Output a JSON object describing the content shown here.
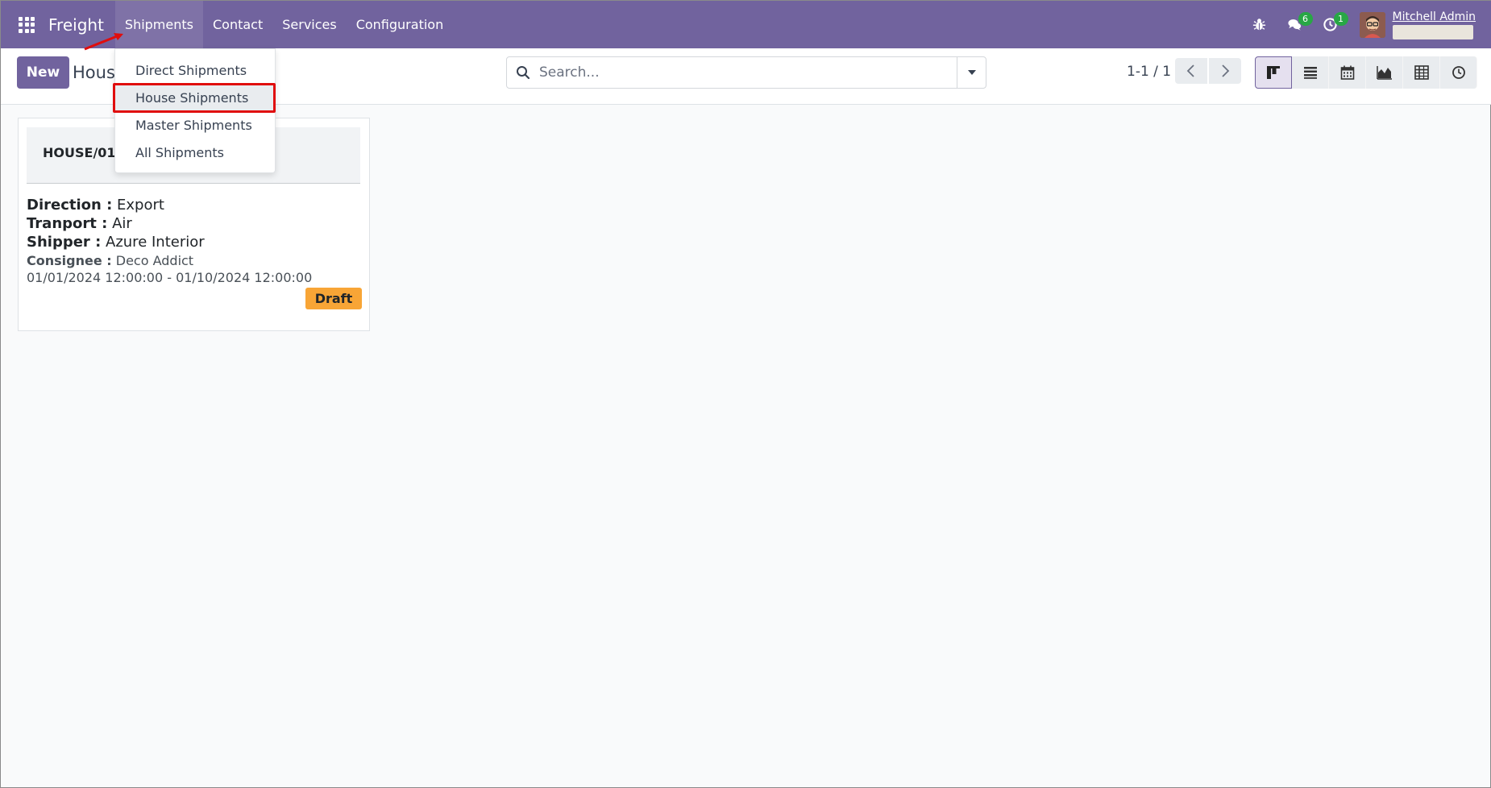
{
  "navbar": {
    "app_name": "Freight",
    "menu": [
      "Shipments",
      "Contact",
      "Services",
      "Configuration"
    ],
    "messages_count": "6",
    "activities_count": "1",
    "user_name": "Mitchell Admin"
  },
  "control_panel": {
    "new_label": "New",
    "breadcrumb": "House",
    "search_placeholder": "Search...",
    "pager": "1-1 / 1"
  },
  "dropdown": {
    "items": [
      "Direct Shipments",
      "House Shipments",
      "Master Shipments",
      "All Shipments"
    ]
  },
  "card": {
    "reference": "HOUSE/01/",
    "direction_label": "Direction :",
    "direction_value": "Export",
    "transport_label": "Tranport :",
    "transport_value": "Air",
    "shipper_label": "Shipper :",
    "shipper_value": "Azure Interior",
    "consignee_label": "Consignee :",
    "consignee_value": "Deco Addict",
    "dates": "01/01/2024 12:00:00 - 01/10/2024 12:00:00",
    "status": "Draft"
  },
  "colors": {
    "brand": "#71639e",
    "draft": "#f8a536",
    "annotation": "#e00d0d",
    "badge": "#28a745"
  }
}
